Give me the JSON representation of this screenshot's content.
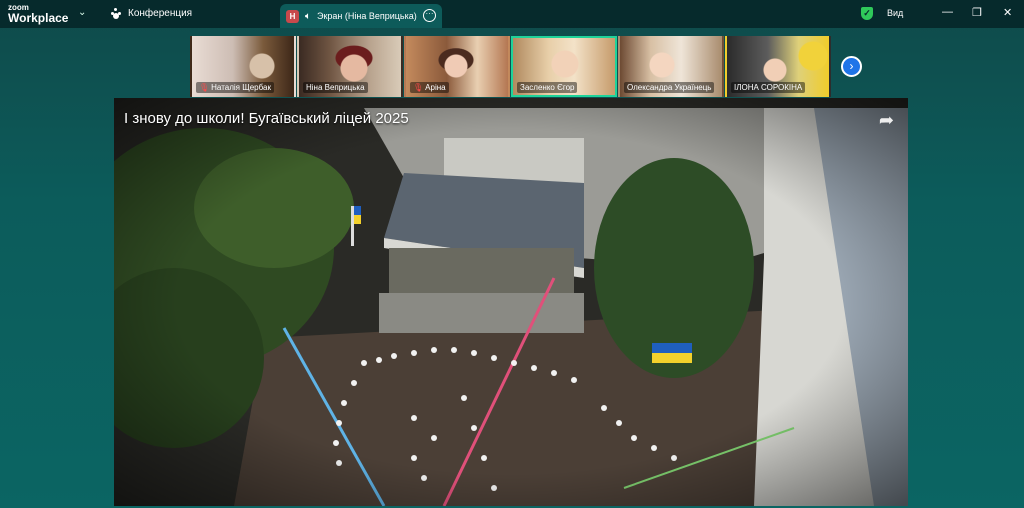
{
  "app": {
    "logo_line1": "zoom",
    "logo_line2": "Workplace"
  },
  "titlebar": {
    "meeting_label": "Конференция",
    "share_tab_label": "Экран (Ніна Веприцька)",
    "share_avatar_letter": "Н",
    "view_label": "Вид"
  },
  "participants": [
    {
      "name": "Наталія Щербак",
      "muted": true
    },
    {
      "name": "Ніна Веприцька",
      "muted": false
    },
    {
      "name": "Аріна",
      "muted": true
    },
    {
      "name": "Засленко Єгор",
      "muted": false,
      "active": true
    },
    {
      "name": "Олександра Українець",
      "muted": false
    },
    {
      "name": "ІЛОНА  СОРОКІНА",
      "muted": false
    }
  ],
  "video": {
    "title": "І знову до школи! Бугаївський ліцей 2025"
  },
  "colors": {
    "accent": "#1fd39a",
    "titlebar": "#062a2c",
    "next_button": "#1f74e8"
  }
}
